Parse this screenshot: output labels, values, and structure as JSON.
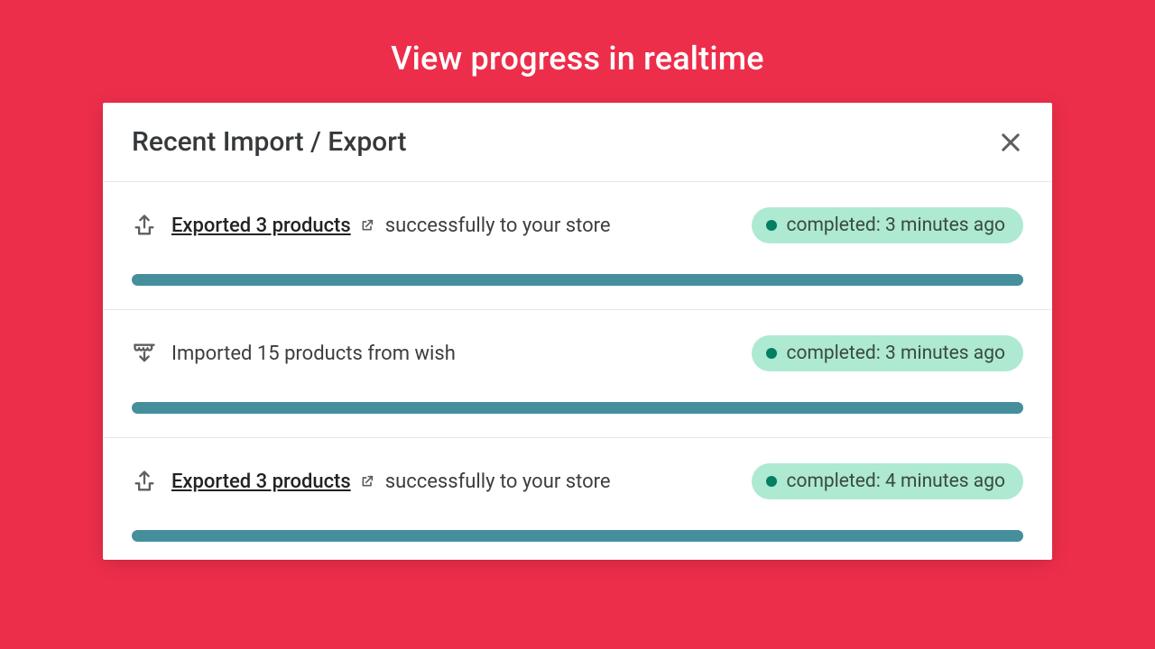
{
  "colors": {
    "background": "#ed2e4b",
    "progress_bar": "#458f9d",
    "badge_bg": "#aee9d1",
    "badge_dot": "#008060"
  },
  "page": {
    "title": "View progress in realtime"
  },
  "panel": {
    "title": "Recent Import / Export"
  },
  "items": [
    {
      "icon": "export-icon",
      "link_text": "Exported 3 products",
      "has_link": true,
      "suffix_text": "successfully to your store",
      "status": "completed: 3 minutes ago",
      "progress": 100
    },
    {
      "icon": "store-import-icon",
      "has_link": false,
      "plain_text": "Imported 15 products from wish",
      "status": "completed: 3 minutes ago",
      "progress": 100
    },
    {
      "icon": "export-icon",
      "link_text": "Exported 3 products",
      "has_link": true,
      "suffix_text": "successfully to your store",
      "status": "completed: 4 minutes ago",
      "progress": 100
    }
  ]
}
